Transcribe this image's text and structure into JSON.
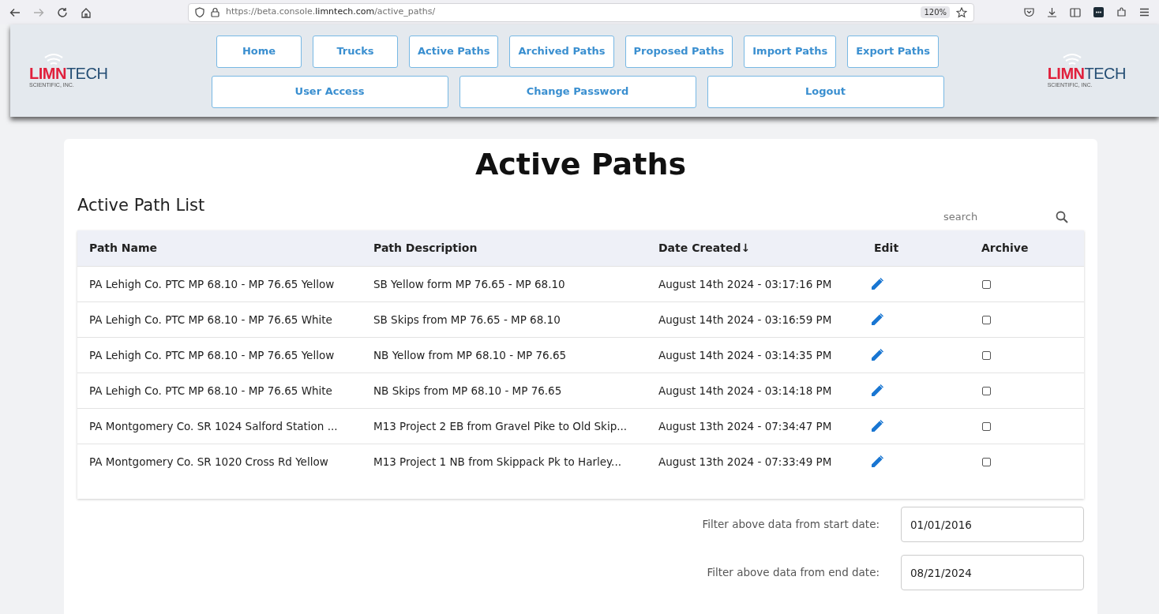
{
  "browser": {
    "url": "https://beta.console.**limntech.com**/active_paths/",
    "zoom": "120%"
  },
  "logos": [
    {
      "red": "LIMN",
      "blue": "TECH",
      "tagline": "SCIENTIFIC, INC."
    },
    {
      "red": "LIMN",
      "blue": "TECH",
      "tagline": "SCIENTIFIC, INC."
    }
  ],
  "nav_rows": [
    [
      {
        "label": "Home",
        "selected": false
      },
      {
        "label": "Trucks",
        "selected": false
      },
      {
        "label": "Active Paths",
        "selected": false
      },
      {
        "label": "Archived Paths",
        "selected": false
      },
      {
        "label": "Proposed Paths",
        "selected": false
      },
      {
        "label": "Import Paths",
        "selected": false
      },
      {
        "label": "Export Paths",
        "selected": false
      }
    ],
    [
      {
        "label": "User Access",
        "selected": false
      },
      {
        "label": "Change Password",
        "selected": false
      },
      {
        "label": "Logout",
        "selected": false
      }
    ]
  ],
  "page_title": "Active Paths",
  "list_title": "Active Path List",
  "search": {
    "placeholder": "search"
  },
  "table": {
    "columns": [
      {
        "label": "Path Name"
      },
      {
        "label": "Path Description"
      },
      {
        "label": "Date Created",
        "sort_indicator": "↓"
      },
      {
        "label": "Edit"
      },
      {
        "label": "Archive"
      }
    ],
    "rows": [
      {
        "name": "PA Lehigh Co. PTC MP 68.10 - MP 76.65 Yellow",
        "description": "SB Yellow form MP 76.65 - MP 68.10",
        "created": "August 14th 2024 - 03:17:16 PM",
        "archived": false
      },
      {
        "name": "PA Lehigh Co. PTC MP 68.10 - MP 76.65 White",
        "description": "SB Skips from MP 76.65 - MP 68.10",
        "created": "August 14th 2024 - 03:16:59 PM",
        "archived": false
      },
      {
        "name": "PA Lehigh Co. PTC MP 68.10 - MP 76.65 Yellow",
        "description": "NB Yellow from MP 68.10 - MP 76.65",
        "created": "August 14th 2024 - 03:14:35 PM",
        "archived": false
      },
      {
        "name": "PA Lehigh Co. PTC MP 68.10 - MP 76.65 White",
        "description": "NB Skips from MP 68.10 - MP 76.65",
        "created": "August 14th 2024 - 03:14:18 PM",
        "archived": false
      },
      {
        "name": "PA Montgomery Co. SR 1024 Salford Station ...",
        "description": "M13 Project 2 EB from Gravel Pike to Old Skip...",
        "created": "August 13th 2024 - 07:34:47 PM",
        "archived": false
      },
      {
        "name": "PA Montgomery Co. SR 1020 Cross Rd Yellow",
        "description": "M13 Project 1 NB from Skippack Pk to Harley...",
        "created": "August 13th 2024 - 07:33:49 PM",
        "archived": false
      }
    ]
  },
  "filters": [
    {
      "label": "Filter above data from start date:",
      "value": "01/01/2016"
    },
    {
      "label": "Filter above data from end date:",
      "value": "08/21/2024"
    }
  ]
}
